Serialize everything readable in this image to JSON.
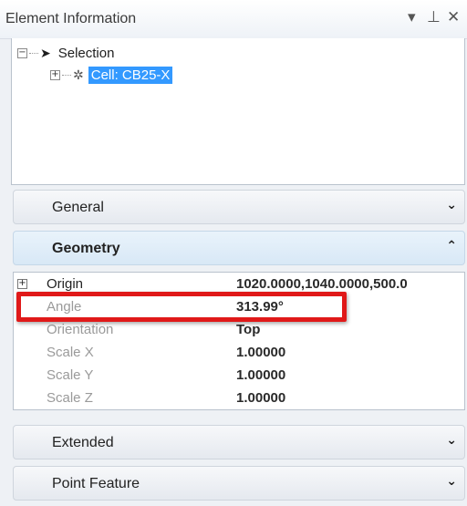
{
  "panel": {
    "title": "Element Information",
    "pin_glyph": "▾ ⅃",
    "close_glyph": "✕"
  },
  "tree": {
    "root_label": "Selection",
    "child_label": "Cell: CB25-X"
  },
  "sections": {
    "general": "General",
    "geometry": "Geometry",
    "extended": "Extended",
    "point_feature": "Point Feature"
  },
  "properties": [
    {
      "name": "Origin",
      "value": "1020.0000,1040.0000,500.0"
    },
    {
      "name": "Angle",
      "value": "313.99°"
    },
    {
      "name": "Orientation",
      "value": "Top"
    },
    {
      "name": "Scale X",
      "value": "1.00000"
    },
    {
      "name": "Scale Y",
      "value": "1.00000"
    },
    {
      "name": "Scale Z",
      "value": "1.00000"
    }
  ],
  "colors": {
    "highlight": "#e01919",
    "selection": "#3399ff"
  }
}
